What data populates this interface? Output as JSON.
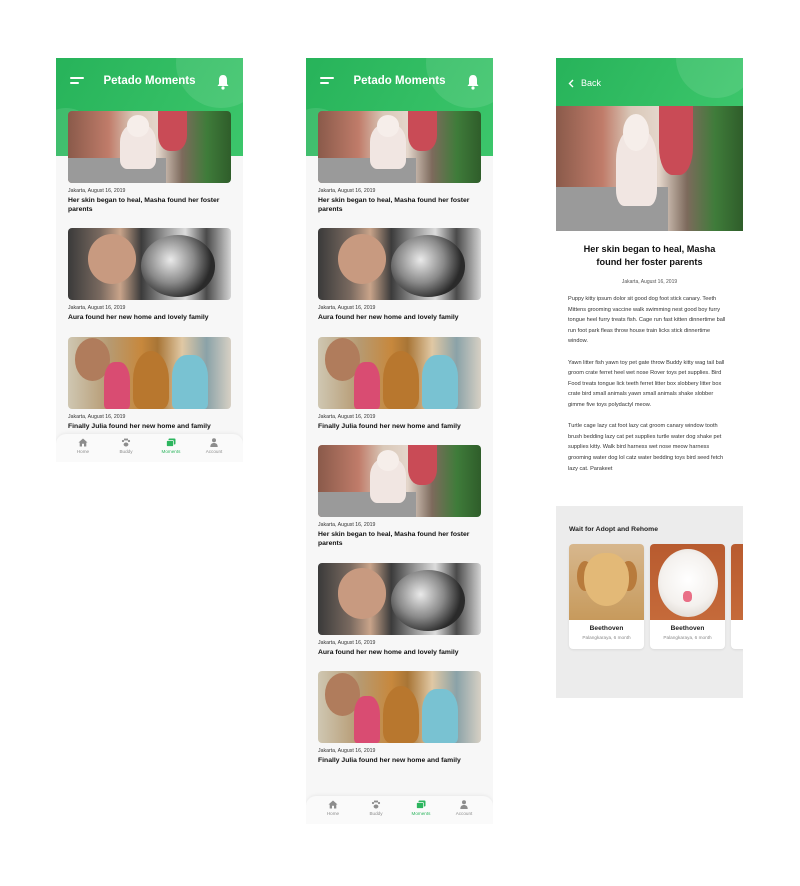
{
  "app": {
    "title": "Petado Moments"
  },
  "feed_screen_short": {
    "posts": [
      {
        "date": "Jakarta, August 16, 2019",
        "title": "Her skin began to heal, Masha found her foster parents",
        "photo": "pink-skin-dog"
      },
      {
        "date": "Jakarta, August 16, 2019",
        "title": "Aura found her new home and lovely family",
        "photo": "woman-kissing-collie"
      },
      {
        "date": "Jakarta, August 16, 2019",
        "title": "Finally Julia found her new home and family",
        "photo": "family-with-golden-dog"
      }
    ]
  },
  "feed_screen_long": {
    "posts": [
      {
        "date": "Jakarta, August 16, 2019",
        "title": "Her skin began to heal, Masha found her foster parents",
        "photo": "pink-skin-dog"
      },
      {
        "date": "Jakarta, August 16, 2019",
        "title": "Aura found her new home and lovely family",
        "photo": "woman-kissing-collie"
      },
      {
        "date": "Jakarta, August 16, 2019",
        "title": "Finally Julia found her new home and family",
        "photo": "family-with-golden-dog"
      },
      {
        "date": "Jakarta, August 16, 2019",
        "title": "Her skin began to heal, Masha found her foster parents",
        "photo": "pink-skin-dog"
      },
      {
        "date": "Jakarta, August 16, 2019",
        "title": "Aura found her new home and lovely family",
        "photo": "woman-kissing-collie"
      },
      {
        "date": "Jakarta, August 16, 2019",
        "title": "Finally Julia found her new home and family",
        "photo": "family-with-golden-dog"
      }
    ]
  },
  "nav": {
    "items": [
      {
        "label": "Home",
        "icon": "home-icon",
        "active": false
      },
      {
        "label": "Buddy",
        "icon": "paw-icon",
        "active": false
      },
      {
        "label": "Moments",
        "icon": "gallery-icon",
        "active": true
      },
      {
        "label": "Account",
        "icon": "user-icon",
        "active": false
      }
    ]
  },
  "detail": {
    "back_label": "Back",
    "title": "Her skin began to heal, Masha found her foster parents",
    "date": "Jakarta, August 16, 2019",
    "paragraphs": [
      "Puppy kitty ipsum dolor sit good dog foot stick canary. Teeth Mittens grooming vaccine walk swimming nest good boy furry tongue heel furry treats fish. Cage run fast kitten dinnertime ball run foot park fleas throw house train licks stick dinnertime window.",
      "Yawn litter fish yawn toy pet gate throw Buddy kitty wag tail ball groom crate ferret heel wet nose Rover toys pet supplies. Bird Food treats tongue lick teeth ferret litter box slobbery litter box crate bird small animals yawn small animals shake slobber gimme five toys polydactyl meow.",
      "Turtle cage lazy cat foot lazy cat groom canary window tooth brush bedding lazy cat pet supplies turtle water dog shake pet supplies kitty. Walk bird harness wet nose meow harness grooming water dog lol catz water bedding toys bird seed fetch lazy cat. Parakeet"
    ],
    "adopt": {
      "heading": "Wait for Adopt and Rehome",
      "pets": [
        {
          "name": "Beethoven",
          "location": "Palangkaraya, 6 month",
          "photo": "golden-retriever-puppy"
        },
        {
          "name": "Beethoven",
          "location": "Palangkaraya, 6 month",
          "photo": "white-fluffy-puppy"
        }
      ]
    }
  },
  "colors": {
    "brand_green": "#2cb55e",
    "nav_inactive": "#8d8d8d"
  }
}
